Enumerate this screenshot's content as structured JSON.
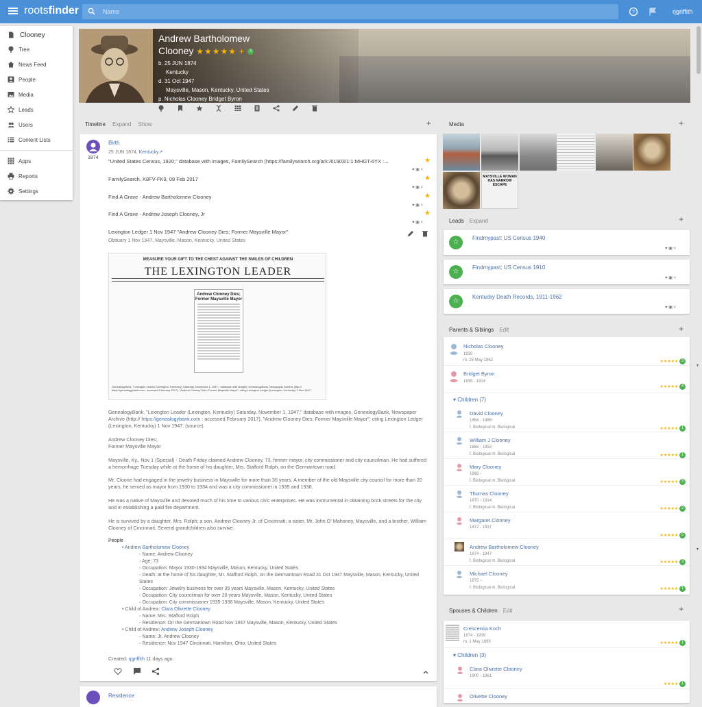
{
  "app": {
    "logo_light": "roots",
    "logo_bold": "finder",
    "search_placeholder": "Name",
    "username": "rjgriffith"
  },
  "sidebar": {
    "title": "Clooney",
    "items": [
      "Tree",
      "News Feed",
      "People",
      "Media",
      "Leads",
      "Users",
      "Content Lists"
    ],
    "items2": [
      "Apps",
      "Reports",
      "Settings"
    ]
  },
  "person": {
    "name_line1": "Andrew Bartholomew",
    "name_line2": "Clooney",
    "stars": "★★★★★",
    "plus": "+",
    "badge": "3",
    "birth": "b. 25 JUN 1874",
    "birth_place": "Kentucky",
    "death": "d. 31 Oct 1947",
    "death_place": "Maysville, Mason, Kentucky, United States",
    "parents": "p.  Nicholas Clooney    Bridget Byron"
  },
  "timeline": {
    "tab": "Timeline",
    "expand": "Expand",
    "show": "Show",
    "event": "Birth",
    "year": "1874",
    "date": "25 JUN 1874,",
    "place": "Kentucky",
    "sources": [
      "\"United States Census, 1920,\" database with images, FamilySearch (https://familysearch.org/ark:/61903/1:1:MHGT-6YX :...",
      "FamilySearch, K8FV-FK9, 08 Feb 2017",
      "Find A Grave - Andrew Bartholomew Clooney",
      "Find A Grave - Andrew Joseph Clooney, Jr"
    ],
    "ledger_title": "Lexington Ledger 1 Nov 1947 \"Andrew Clooney Dies; Former Maysville Mayor\"",
    "ledger_sub": "Obituary 1 Nov 1947, Maysville, Mason, Kentucky, United States",
    "np_header": "MEASURE YOUR GIFT TO THE CHEST AGAINST THE SMILES OF CHILDREN",
    "np_title": "THE LEXINGTON LEADER",
    "np_col_head": "Andrew Clooney Dies; Former Maysville Mayor",
    "np_caption": "GenealogyBank, \"Lexington Leader (Lexington, Kentucky) Saturday, November 1, 1947,\" database with images, GenealogyBank, Newspaper Archive (http:// https://genealogybank.com : accessed February 2017), \"Andrew Clooney Dies; Former Maysville Mayor\"; citing Lexington Ledger (Lexington, Kentucky) 1 Nov 1947.",
    "citation_a": "GenealogyBank, \"Lexington Leader (Lexington, Kentucky) Saturday, November 1, 1947,\" database with images, GenealogyBank, Newspaper Archive (http:// ",
    "citation_link": "https://genealogybank.com",
    "citation_b": " : accessed February 2017), \"Andrew Clooney Dies; Former Maysville Mayor\"; citing Lexington Ledger (Lexington, Kentucky) 1 Nov 1947. (source)",
    "heading1": "Andrew Clooney Dies;",
    "heading2": "Former Maysville Mayor",
    "p1": "Maysville, Ky., Nov 1 (Special) - Death Friday claimed Andrew Clooney, 73, former mayor, city commissioner and city councilman. He had suffered a hemorrhage Tuesday while at the home of his daughter, Mrs. Stafford Rolph, on the Germantown road.",
    "p2": "Mr. Cloone had engaged in the jewelry business in Maysville for more than 35 years. A member of the old Maysville city council for more than 20 years, he served as mayor from 1930 to 1934 and was a city commissioner in 1935 and 1936.",
    "p3": "He was a native of Maysville and devoted much of his time to various civic enterprises. He was instrumental in obtaining brick streets for the city and in establishing a paid fire department.",
    "p4": "He is survived by a daughter, Mrs. Rolph; a son, Andrew Clooney Jr. of Cincinnati; a sister, Mr. John O' Mahoney, Maysville, and a brother, William Clooney of Cincinnati. Several grandchildren also survive.",
    "people_label": "People",
    "p_andrew": "Andrew Bartholomew Clooney",
    "p_andrew_items": [
      "Name: Andrew Clooney",
      "Age: 73",
      "Occupation: Mayor 1930-1934 Maysville, Mason, Kentucky, United States",
      "Death: at the home of his daughter, Mr. Stafford Rolph, on the Germantown Road 31 Oct 1947 Maysville, Mason, Kentucky, United States",
      "Occupation: Jewelry business for over 35 years Maysville, Mason, Kentucky, United States",
      "Occupation: City councilman for over 20 years Maysville, Mason, Kentucky, United States",
      "Occupation: City commissioner 1935-1936 Maysville, Mason, Kentucky, United States"
    ],
    "child1_prefix": "Child of Andrew: ",
    "child1": "Clara Oliviette Clooney",
    "child1_items": [
      "Name: Mrs. Stafford Rolph",
      "Residence: On the Germantown Road Nov 1947 Maysville, Mason, Kentucky, United States"
    ],
    "child2_prefix": "Child of Andrew: ",
    "child2": "Andrew Joseph Clooney",
    "child2_items": [
      "Name: Jr. Andrew Clooney",
      "Residence: Nov 1947 Cincinnati, Hamilton, Ohio, United States"
    ],
    "created": "Created: ",
    "created_by": "rjgriffith",
    "created_ago": " 11 days ago",
    "next_event": "Residence"
  },
  "media": {
    "label": "Media",
    "np_headline": "MAYSVILLE WOMAN HAS NARROW ESCAPE"
  },
  "leads": {
    "label": "Leads",
    "expand": "Expand",
    "items": [
      "Findmypast: US Census 1940",
      "Findmypast: US Census 1910",
      "Kentucky Death Records, 1911-1962"
    ]
  },
  "parents": {
    "label": "Parents & Siblings",
    "edit": "Edit",
    "father": {
      "name": "Nicholas Clooney",
      "dates": "1830 -",
      "marriage": "m. 25 May 1862",
      "badge": "3"
    },
    "mother": {
      "name": "Bridget Byron",
      "dates": "1835 - 1914",
      "badge": "4"
    },
    "children_label": "Children (7)",
    "children": [
      {
        "name": "David Clooney",
        "dates": "1864 - 1886",
        "rel": "f. Biological   m. Biological",
        "badge": "1"
      },
      {
        "name": "William J Clooney",
        "dates": "1866 - 1953",
        "rel": "f. Biological   m. Biological",
        "badge": "1"
      },
      {
        "name": "Mary Clooney",
        "dates": "1868 -",
        "rel": "f. Biological   m. Biological",
        "badge": "3"
      },
      {
        "name": "Thomas Clooney",
        "dates": "1870 - 1914",
        "rel": "f. Biological   m. Biological",
        "badge": "2"
      },
      {
        "name": "Margaret Clooney",
        "dates": "1872 - 1937",
        "rel": "",
        "badge": "5"
      },
      {
        "name": "Andrew Bartholomew Clooney",
        "dates": "1874 - 1947",
        "rel": "f. Biological   m. Biological",
        "badge": "3"
      },
      {
        "name": "Michael Clooney",
        "dates": "1875 -",
        "rel": "f. Biological   m. Biological",
        "badge": "1"
      }
    ]
  },
  "spouses": {
    "label": "Spouses & Children",
    "edit": "Edit",
    "spouse": {
      "name": "Crescentia Koch",
      "dates": "1874 - 1939",
      "marriage": "m. 1 May 1899",
      "badge": "1"
    },
    "children_label": "Children (3)",
    "children": [
      {
        "name": "Clara Oliviette Clooney",
        "dates": "1900 - 1961",
        "badge": "1"
      },
      {
        "name": "Olivette Clooney",
        "dates": "",
        "badge": ""
      }
    ]
  },
  "colors": {
    "brand": "#4a90d9",
    "star": "#f5b400",
    "badge": "#4caf50",
    "link": "#4a6fa5",
    "avatar": "#6b4fbb"
  }
}
